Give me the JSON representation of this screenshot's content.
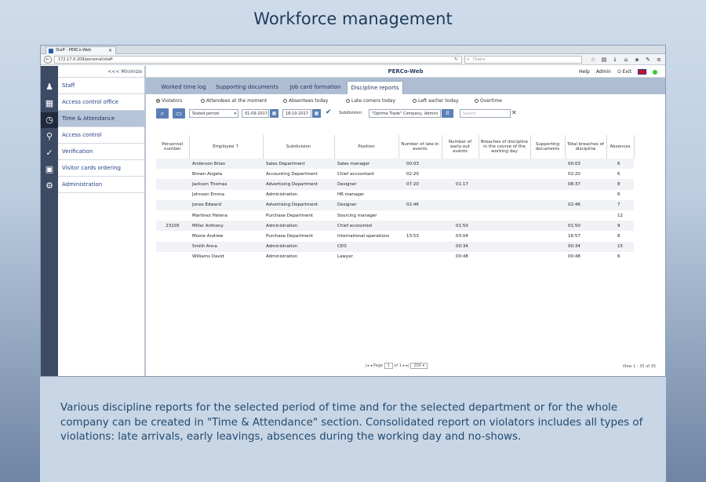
{
  "page_title": "Workforce management",
  "browser": {
    "tab_title": "Staff - PERCo-Web",
    "url": "172.17.0.209/personal/staff",
    "search_placeholder": "Поиск"
  },
  "app": {
    "title": "PERCo-Web",
    "help": "Help",
    "user": "Admin",
    "exit": "Exit",
    "minimize": "<<< Minimize"
  },
  "sidebar": {
    "items": [
      {
        "label": "Staff",
        "icon": "staff-icon"
      },
      {
        "label": "Access control office",
        "icon": "access-office-icon"
      },
      {
        "label": "Time & Attendance",
        "icon": "time-attendance-icon",
        "active": true
      },
      {
        "label": "Access control",
        "icon": "key-icon"
      },
      {
        "label": "Verification",
        "icon": "verification-icon"
      },
      {
        "label": "Visitor cards ordering",
        "icon": "visitor-cards-icon"
      },
      {
        "label": "Administration",
        "icon": "gear-icon"
      }
    ]
  },
  "tabs": [
    "Worked time log",
    "Supporting documents",
    "Job card formation",
    "Discipline reports"
  ],
  "radios": [
    "Violators",
    "Attendees at the moment",
    "Absentees today",
    "Late comers today",
    "Left earlier today",
    "Overtime"
  ],
  "filters": {
    "period": "Stated period",
    "date_from": "01-09-2017",
    "date_to": "18-10-2017",
    "subdivision_label": "Subdivision:",
    "subdivision_value": "\"Optima Trade\" Company, Admini",
    "search_placeholder": "Search"
  },
  "table": {
    "headers": [
      "Personnel number",
      "Employee ↑",
      "Subdivision",
      "Position",
      "Number of late-in events",
      "Number of early-out events",
      "Breaches of discipline in the course of the working day",
      "Supporting documents",
      "Total breaches of discipline",
      "Absences"
    ],
    "rows": [
      [
        "",
        "Anderson Brian",
        "Sales Department",
        "Sales manager",
        "00:03",
        "",
        "",
        "",
        "00:03",
        "6"
      ],
      [
        "",
        "Brown Angela",
        "Accounting Department",
        "Chief accountant",
        "02:20",
        "",
        "",
        "",
        "02:20",
        "6"
      ],
      [
        "",
        "Jackson Thomas",
        "Advertising Department",
        "Designer",
        "07:20",
        "01:17",
        "",
        "",
        "08:37",
        "8"
      ],
      [
        "",
        "Johnson Emma",
        "Administration",
        "HR manager",
        "",
        "",
        "",
        "",
        "",
        "6"
      ],
      [
        "",
        "Jones Edward",
        "Advertising Department",
        "Designer",
        "02:46",
        "",
        "",
        "",
        "02:46",
        "7"
      ],
      [
        "",
        "Martinez Helena",
        "Purchase Department",
        "Sourcing manager",
        "",
        "",
        "",
        "",
        "",
        "12"
      ],
      [
        "23105",
        "Miller Anthony",
        "Administration",
        "Chief economist",
        "",
        "01:50",
        "",
        "",
        "01:50",
        "9"
      ],
      [
        "",
        "Moore Andrew",
        "Purchase Department",
        "International operations",
        "13:53",
        "03:04",
        "",
        "",
        "16:57",
        "8"
      ],
      [
        "",
        "Smith Anna",
        "Administration",
        "CEO",
        "",
        "00:34",
        "",
        "",
        "00:34",
        "15"
      ],
      [
        "",
        "Williams David",
        "Administration",
        "Lawyer",
        "",
        "00:48",
        "",
        "",
        "00:48",
        "6"
      ]
    ]
  },
  "pager": {
    "page_label": "Page",
    "page": "1",
    "of": "of 1",
    "per_page": "200",
    "view_info": "View 1 - 35 of 35"
  },
  "description": "Various discipline reports for the selected period of time and for the selected department or for the whole company can be created in \"Time & Attendance\" section. Consolidated report on violators includes all types of violations: late arrivals, early leavings, absences during the working day and no-shows."
}
